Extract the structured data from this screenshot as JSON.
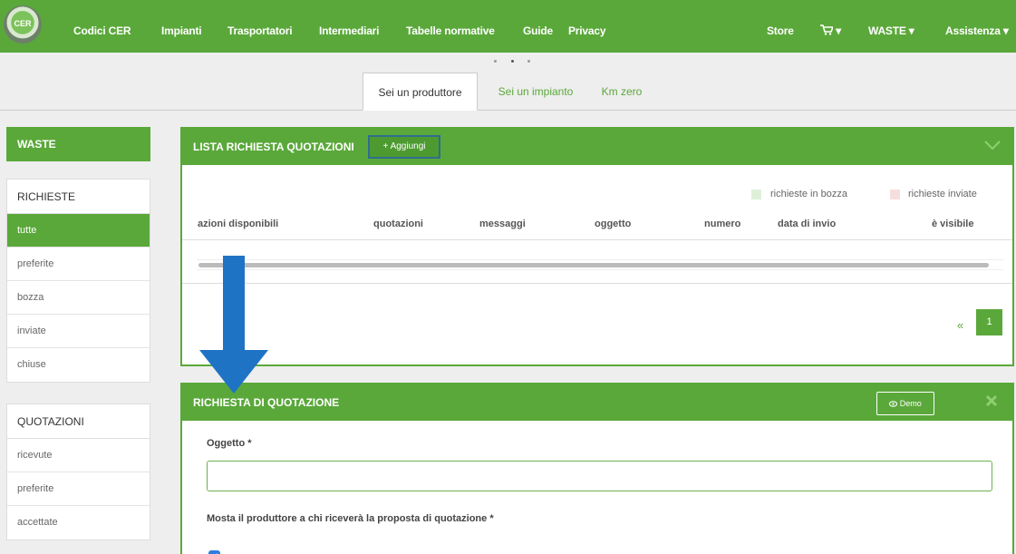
{
  "logo": {
    "text": "CER"
  },
  "topnav": {
    "items": [
      "Codici CER",
      "Impianti",
      "Trasportatori",
      "Intermediari",
      "Tabelle normative",
      "Guide",
      "Privacy"
    ],
    "right": [
      "Store",
      "▾",
      "WASTE ▾",
      "Assistenza ▾"
    ],
    "cart_icon": "cart-icon"
  },
  "tabs": [
    "Sei un produttore",
    "Sei un impianto",
    "Km zero"
  ],
  "sidebar": {
    "header": "WASTE",
    "richieste": {
      "title": "RICHIESTE",
      "items": [
        "tutte",
        "preferite",
        "bozza",
        "inviate",
        "chiuse"
      ]
    },
    "quotazioni": {
      "title": "QUOTAZIONI",
      "items": [
        "ricevute",
        "preferite",
        "accettate"
      ]
    }
  },
  "lista": {
    "title": "LISTA RICHIESTA QUOTAZIONI",
    "add_label": "+ Aggiungi",
    "legend": [
      "richieste in bozza",
      "richieste inviate"
    ],
    "legend_colors": [
      "#dff0d8",
      "#f7dede"
    ],
    "columns": [
      "azioni disponibili",
      "quotazioni",
      "messaggi",
      "oggetto",
      "numero",
      "data di invio",
      "è visibile"
    ],
    "pagination": {
      "prev": "«",
      "current": "1"
    }
  },
  "richiesta": {
    "title": "RICHIESTA DI QUOTAZIONE",
    "demo_label": "Demo",
    "oggetto_label": "Oggetto *",
    "oggetto_value": "",
    "mostra_label": "Mosta il produttore a chi riceverà la proposta di quotazione *",
    "mostra_checked": true
  },
  "colors": {
    "accent": "#5aa83a",
    "arrow": "#1f73c4",
    "checkbox": "#2f7de0"
  }
}
